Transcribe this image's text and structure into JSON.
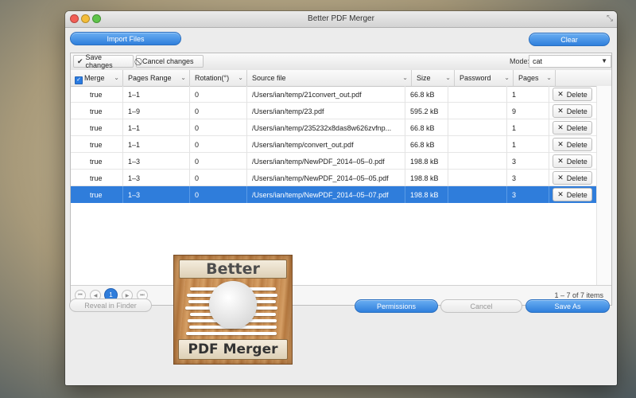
{
  "window": {
    "title": "Better PDF Merger"
  },
  "top_buttons": {
    "import": "Import Files",
    "clear": "Clear"
  },
  "toolbar": {
    "save": "Save changes",
    "cancel": "Cancel changes",
    "mode_label": "Mode:",
    "mode_value": "cat"
  },
  "columns": [
    "Merge",
    "Pages Range",
    "Rotation(°)",
    "Source file",
    "Size",
    "Password",
    "Pages"
  ],
  "rows": [
    {
      "merge": "true",
      "range": "1–1",
      "rotation": "0",
      "source": "/Users/ian/temp/21convert_out.pdf",
      "size": "66.8 kB",
      "password": "",
      "pages": "1",
      "delete": "Delete"
    },
    {
      "merge": "true",
      "range": "1–9",
      "rotation": "0",
      "source": "/Users/ian/temp/23.pdf",
      "size": "595.2 kB",
      "password": "",
      "pages": "9",
      "delete": "Delete"
    },
    {
      "merge": "true",
      "range": "1–1",
      "rotation": "0",
      "source": "/Users/ian/temp/235232x8das8w626zvfnp...",
      "size": "66.8 kB",
      "password": "",
      "pages": "1",
      "delete": "Delete"
    },
    {
      "merge": "true",
      "range": "1–1",
      "rotation": "0",
      "source": "/Users/ian/temp/convert_out.pdf",
      "size": "66.8 kB",
      "password": "",
      "pages": "1",
      "delete": "Delete"
    },
    {
      "merge": "true",
      "range": "1–3",
      "rotation": "0",
      "source": "/Users/ian/temp/NewPDF_2014–05–0.pdf",
      "size": "198.8 kB",
      "password": "",
      "pages": "3",
      "delete": "Delete"
    },
    {
      "merge": "true",
      "range": "1–3",
      "rotation": "0",
      "source": "/Users/ian/temp/NewPDF_2014–05–05.pdf",
      "size": "198.8 kB",
      "password": "",
      "pages": "3",
      "delete": "Delete"
    },
    {
      "merge": "true",
      "range": "1–3",
      "rotation": "0",
      "source": "/Users/ian/temp/NewPDF_2014–05–07.pdf",
      "size": "198.8 kB",
      "password": "",
      "pages": "3",
      "delete": "Delete"
    }
  ],
  "pagination": {
    "current": "1",
    "summary": "1 – 7 of 7 items"
  },
  "bottom_buttons": {
    "reveal": "Reveal in Finder",
    "permissions": "Permissions",
    "cancel": "Cancel",
    "save_as": "Save As"
  },
  "logo": {
    "top": "Better",
    "bottom": "PDF Merger"
  },
  "colors": {
    "accent": "#2f7ddb",
    "selected_row": "#2f7ddb"
  }
}
